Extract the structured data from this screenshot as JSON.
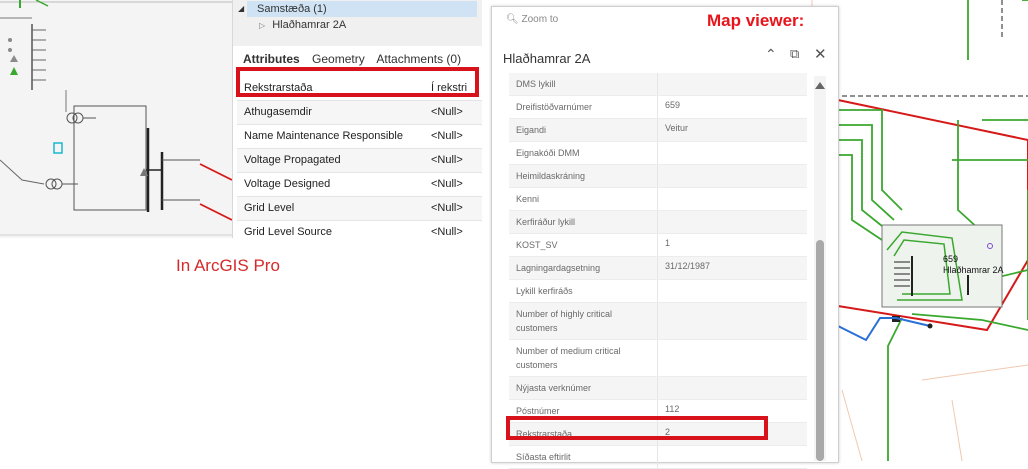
{
  "left": {
    "caption": "In ArcGIS Pro",
    "tree": {
      "selected": "Samstæða (1)",
      "child": "Hlaðhamrar 2A"
    },
    "tabs": [
      "Attributes",
      "Geometry",
      "Attachments (0)"
    ],
    "rows": [
      {
        "key": "Rekstrarstaða",
        "value": "Í rekstri"
      },
      {
        "key": "Athugasemdir",
        "value": "<Null>"
      },
      {
        "key": "Name Maintenance Responsible",
        "value": "<Null>"
      },
      {
        "key": "Voltage Propagated",
        "value": "<Null>"
      },
      {
        "key": "Voltage Designed",
        "value": "<Null>"
      },
      {
        "key": "Grid Level",
        "value": "<Null>"
      },
      {
        "key": "Grid Level Source",
        "value": "<Null>"
      }
    ]
  },
  "viewer": {
    "title_label": "Map viewer:",
    "zoom_placeholder": "Zoom to",
    "panel_title": "Hlaðhamrar 2A",
    "icons": {
      "collapse": "chevron-up-icon",
      "dock": "dock-icon",
      "close": "close-icon",
      "search": "search-icon"
    },
    "rows": [
      {
        "key": "DMS lykill",
        "value": ""
      },
      {
        "key": "Dreifistöðvarnúmer",
        "value": "659"
      },
      {
        "key": "Eigandi",
        "value": "Veitur"
      },
      {
        "key": "Eignakóði DMM",
        "value": ""
      },
      {
        "key": "Heimildaskráning",
        "value": ""
      },
      {
        "key": "Kenni",
        "value": ""
      },
      {
        "key": "Kerfiráður lykill",
        "value": ""
      },
      {
        "key": "KOST_SV",
        "value": "1"
      },
      {
        "key": "Lagningardagsetning",
        "value": "31/12/1987"
      },
      {
        "key": "Lykill kerfiráðs",
        "value": ""
      },
      {
        "key": "Number of highly critical customers",
        "value": ""
      },
      {
        "key": "Number of medium critical customers",
        "value": ""
      },
      {
        "key": "Nýjasta verknúmer",
        "value": ""
      },
      {
        "key": "Póstnúmer",
        "value": "112"
      },
      {
        "key": "Rekstrarstaða",
        "value": "2"
      },
      {
        "key": "Síðasta eftirlit",
        "value": ""
      }
    ],
    "map_label_number": "659",
    "map_label_name": "Hlaðhamrar 2A"
  },
  "colors": {
    "highlight": "#d8121a",
    "green_line": "#3aa82e",
    "red_line": "#d61a1a",
    "blue_line": "#2a6fd6"
  }
}
